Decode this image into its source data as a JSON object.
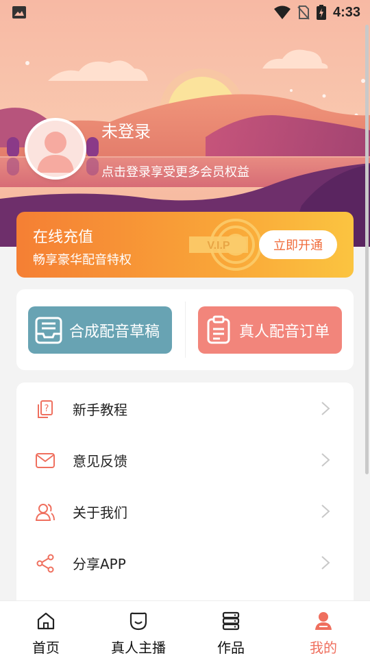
{
  "status_bar": {
    "time": "4:33",
    "icons": [
      "image-icon",
      "wifi-icon",
      "no-sim-icon",
      "battery-charging-icon"
    ]
  },
  "profile": {
    "title": "未登录",
    "subtitle": "点击登录享受更多会员权益",
    "avatar": "avatar-placeholder-icon"
  },
  "vip_card": {
    "title": "在线充值",
    "subtitle": "畅享豪华配音特权",
    "badge_text": "V.I.P",
    "button_label": "立即开通"
  },
  "actions": [
    {
      "label": "合成配音草稿",
      "icon": "draft-box-icon",
      "color": "#68a3b3"
    },
    {
      "label": "真人配音订单",
      "icon": "clipboard-order-icon",
      "color": "#f2857b"
    }
  ],
  "menu": [
    {
      "label": "新手教程",
      "icon": "tutorial-question-icon"
    },
    {
      "label": "意见反馈",
      "icon": "mail-feedback-icon"
    },
    {
      "label": "关于我们",
      "icon": "users-about-icon"
    },
    {
      "label": "分享APP",
      "icon": "share-icon"
    }
  ],
  "bottom_nav": [
    {
      "label": "首页",
      "icon": "home-icon",
      "active": false
    },
    {
      "label": "真人主播",
      "icon": "face-anchor-icon",
      "active": false
    },
    {
      "label": "作品",
      "icon": "works-stack-icon",
      "active": false
    },
    {
      "label": "我的",
      "icon": "profile-person-icon",
      "active": true
    }
  ],
  "colors": {
    "accent": "#ef6f5e",
    "vip_gradient_start": "#f57f34",
    "vip_gradient_end": "#fbc440",
    "menu_icon": "#ef6f5e"
  }
}
